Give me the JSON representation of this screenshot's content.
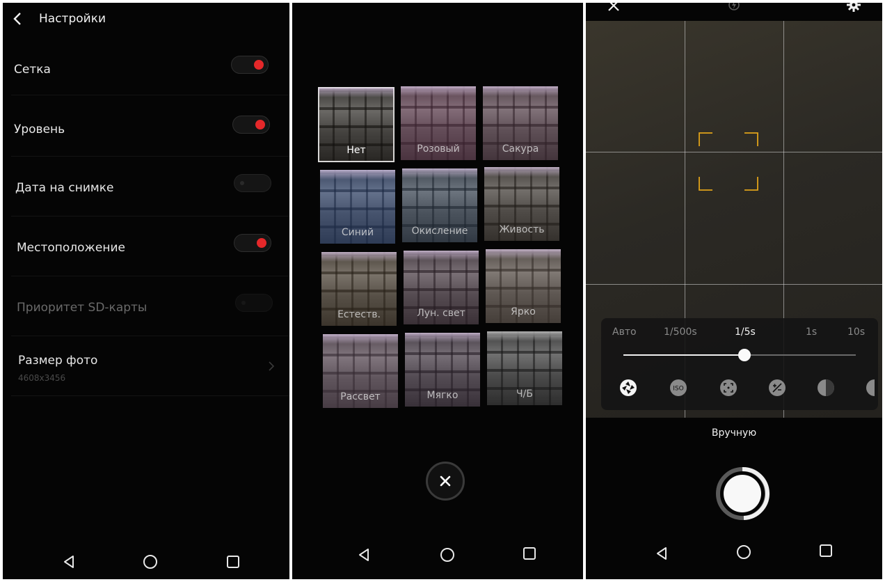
{
  "settings": {
    "title": "Настройки",
    "rows": [
      {
        "label": "Сетка",
        "state": "on"
      },
      {
        "label": "Уровень",
        "state": "on"
      },
      {
        "label": "Дата на снимке",
        "state": "off"
      },
      {
        "label": "Местоположение",
        "state": "on"
      },
      {
        "label": "Приоритет SD-карты",
        "state": "disabled"
      }
    ],
    "photo_size": {
      "label": "Размер фото",
      "value": "4608x3456"
    }
  },
  "filters": {
    "items": [
      "Нет",
      "Розовый",
      "Сакура",
      "Синий",
      "Окисление",
      "Живость",
      "Естеств.",
      "Лун. свет",
      "Ярко",
      "Рассвет",
      "Мягко",
      "Ч/Б"
    ],
    "selected": "Нет"
  },
  "camera": {
    "speeds": [
      "Авто",
      "1/500s",
      "1/5s",
      "1s",
      "10s"
    ],
    "active_speed": "1/5s",
    "slider_level": 0.52,
    "tools": [
      "shutter-speed-icon",
      "iso-icon",
      "focus-icon",
      "exposure-icon",
      "white-balance-icon",
      "contrast-icon"
    ],
    "mode": "Вручную"
  },
  "colors": {
    "toggle_on": "#e5282a",
    "focus_frame": "#e0a21a"
  }
}
